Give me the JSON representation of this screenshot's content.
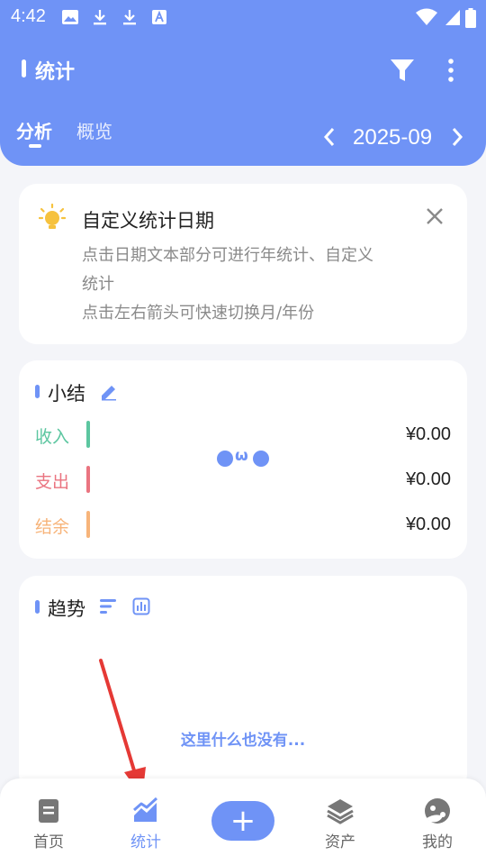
{
  "status": {
    "time": "4:42"
  },
  "header": {
    "title": "统计",
    "tabs": [
      {
        "label": "分析",
        "active": true
      },
      {
        "label": "概览",
        "active": false
      }
    ],
    "month": "2025-09"
  },
  "tip": {
    "title": "自定义统计日期",
    "line1": "点击日期文本部分可进行年统计、自定义",
    "line2": "统计",
    "line3": "点击左右箭头可快速切换月/年份"
  },
  "summary": {
    "title": "小结",
    "face_mouth": "ω",
    "rows": [
      {
        "label": "收入",
        "value": "¥0.00",
        "color": "#5cc6a0"
      },
      {
        "label": "支出",
        "value": "¥0.00",
        "color": "#ea7480"
      },
      {
        "label": "结余",
        "value": "¥0.00",
        "color": "#f7b47a"
      }
    ]
  },
  "trend": {
    "title": "趋势",
    "empty_text": "这里什么也没有..."
  },
  "nav": {
    "items": [
      {
        "label": "首页",
        "icon": "book-icon",
        "active": false
      },
      {
        "label": "统计",
        "icon": "chart-trend-icon",
        "active": true
      },
      {
        "label": "+",
        "icon": "plus-icon",
        "active": false
      },
      {
        "label": "资产",
        "icon": "layers-icon",
        "active": false
      },
      {
        "label": "我的",
        "icon": "avatar-icon",
        "active": false
      }
    ]
  },
  "colors": {
    "accent": "#6f93f6",
    "annotation_arrow": "#e53935"
  }
}
